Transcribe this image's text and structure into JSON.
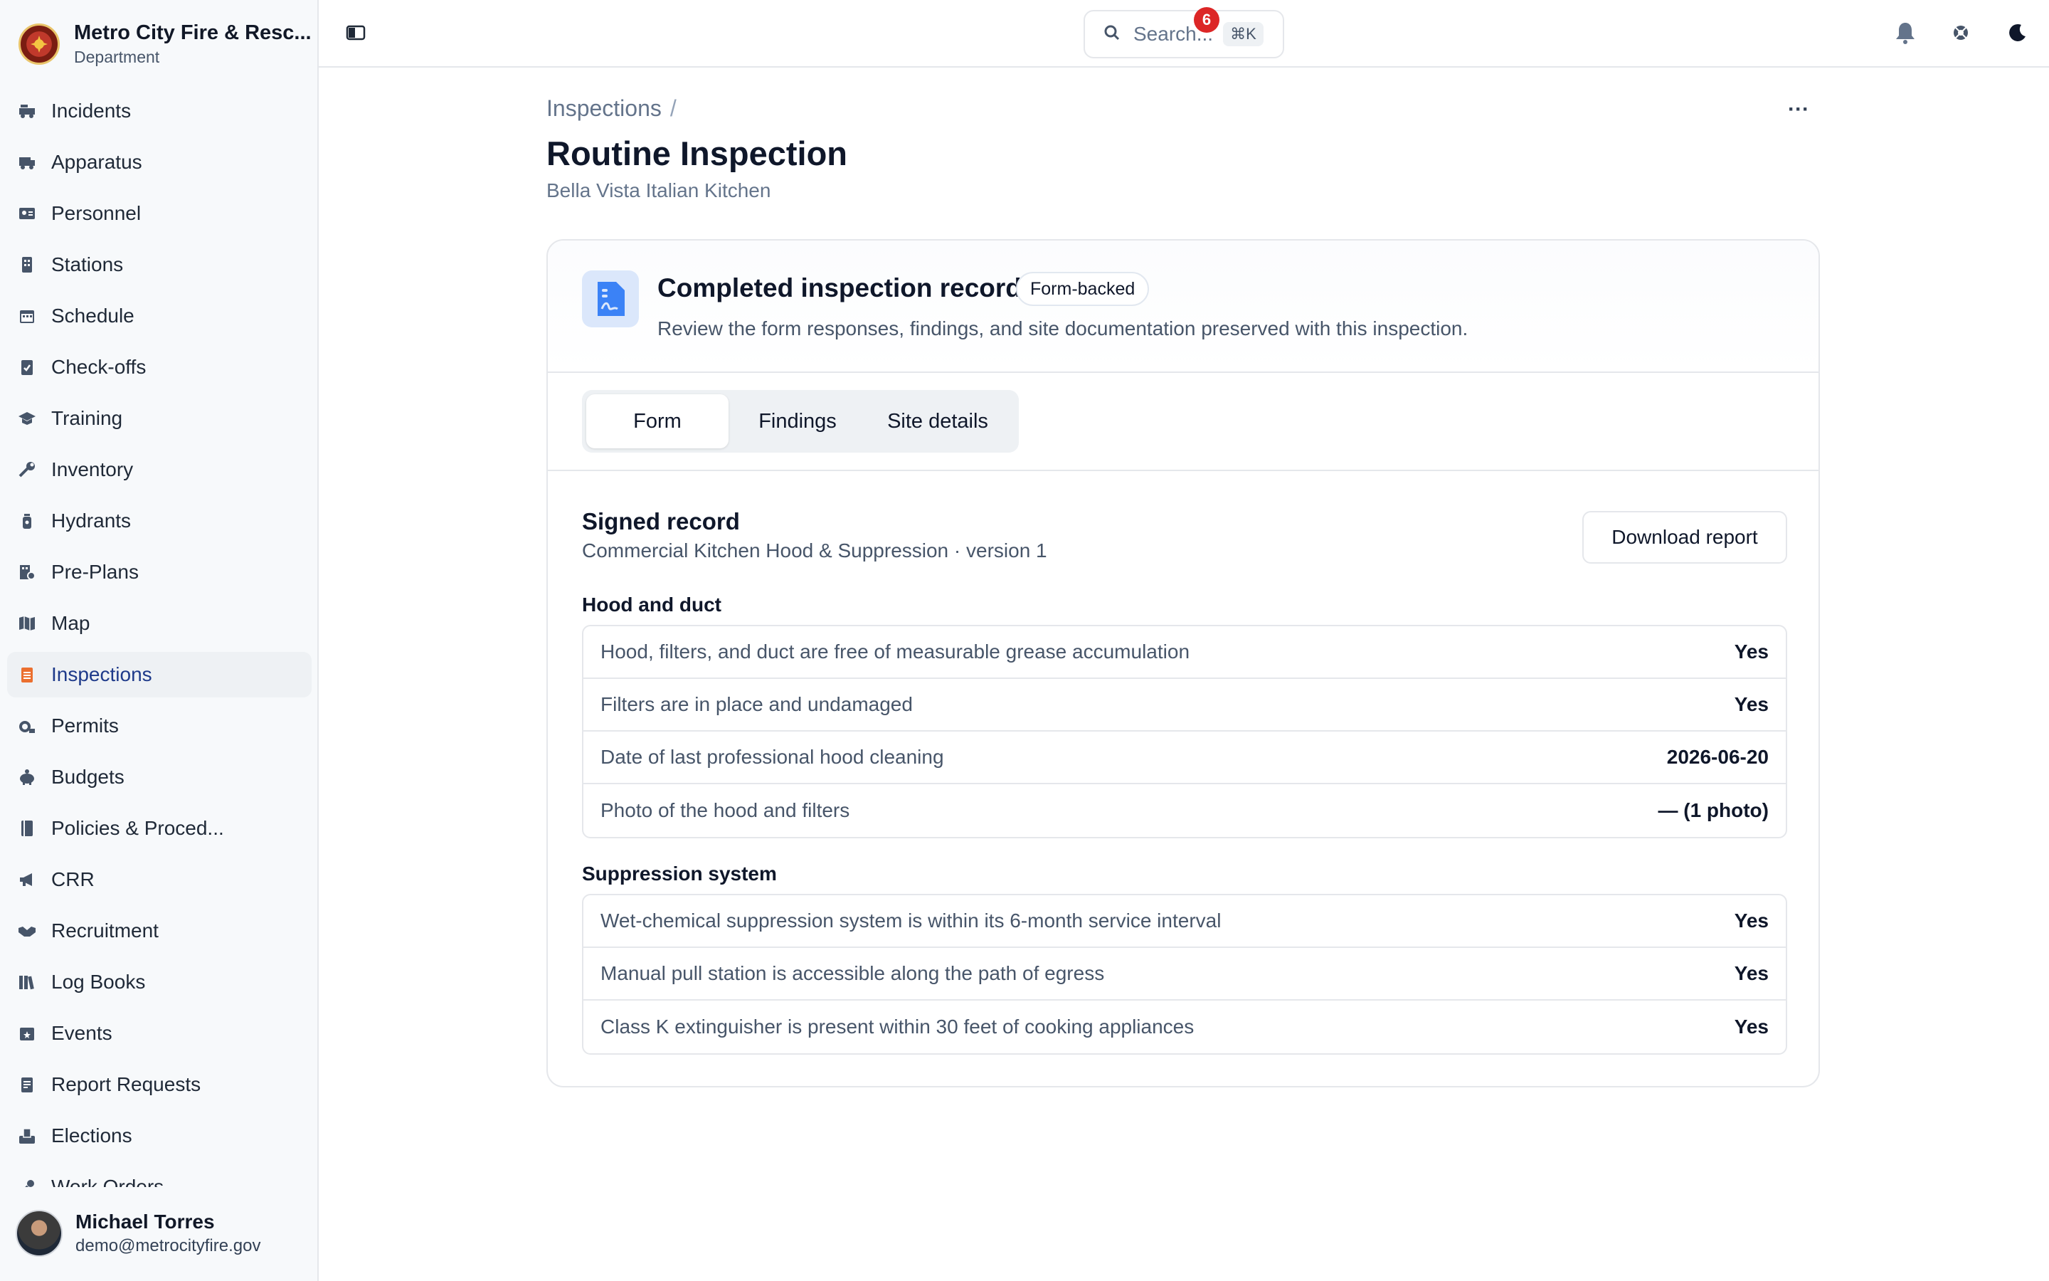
{
  "org": {
    "name": "Metro City Fire & Resc...",
    "sub": "Department"
  },
  "nav": [
    {
      "label": "Incidents",
      "icon": "fire-truck-icon"
    },
    {
      "label": "Apparatus",
      "icon": "truck-icon"
    },
    {
      "label": "Personnel",
      "icon": "id-card-icon"
    },
    {
      "label": "Stations",
      "icon": "building-icon"
    },
    {
      "label": "Schedule",
      "icon": "calendar-icon"
    },
    {
      "label": "Check-offs",
      "icon": "clipboard-check-icon"
    },
    {
      "label": "Training",
      "icon": "graduation-cap-icon"
    },
    {
      "label": "Inventory",
      "icon": "wrench-icon"
    },
    {
      "label": "Hydrants",
      "icon": "hydrant-icon"
    },
    {
      "label": "Pre-Plans",
      "icon": "building-plan-icon"
    },
    {
      "label": "Map",
      "icon": "map-icon"
    },
    {
      "label": "Inspections",
      "icon": "clipboard-list-icon"
    },
    {
      "label": "Permits",
      "icon": "stamp-icon"
    },
    {
      "label": "Budgets",
      "icon": "piggy-bank-icon"
    },
    {
      "label": "Policies & Proced...",
      "icon": "book-icon"
    },
    {
      "label": "CRR",
      "icon": "megaphone-icon"
    },
    {
      "label": "Recruitment",
      "icon": "handshake-icon"
    },
    {
      "label": "Log Books",
      "icon": "books-icon"
    },
    {
      "label": "Events",
      "icon": "calendar-star-icon"
    },
    {
      "label": "Report Requests",
      "icon": "file-icon"
    },
    {
      "label": "Elections",
      "icon": "ballot-box-icon"
    },
    {
      "label": "Work Orders",
      "icon": "tools-icon"
    }
  ],
  "active_nav": "Inspections",
  "user": {
    "name": "Michael Torres",
    "email": "demo@metrocityfire.gov"
  },
  "topbar": {
    "search_placeholder": "Search...",
    "search_shortcut": "⌘K",
    "notification_count": "6"
  },
  "breadcrumb": {
    "parent": "Inspections",
    "separator": "/"
  },
  "page": {
    "title": "Routine Inspection",
    "subtitle": "Bella Vista Italian Kitchen",
    "more": "···"
  },
  "card": {
    "title": "Completed inspection record",
    "tag": "Form-backed",
    "description": "Review the form responses, findings, and site documentation preserved with this inspection."
  },
  "tabs": [
    {
      "label": "Form",
      "active": true
    },
    {
      "label": "Findings",
      "active": false
    },
    {
      "label": "Site details",
      "active": false
    }
  ],
  "record": {
    "title": "Signed record",
    "subtitle": "Commercial Kitchen Hood & Suppression · version 1",
    "download_label": "Download report"
  },
  "sections": [
    {
      "title": "Hood and duct",
      "rows": [
        {
          "q": "Hood, filters, and duct are free of measurable grease accumulation",
          "a": "Yes"
        },
        {
          "q": "Filters are in place and undamaged",
          "a": "Yes"
        },
        {
          "q": "Date of last professional hood cleaning",
          "a": "2026-06-20"
        },
        {
          "q": "Photo of the hood and filters",
          "a": "— (1 photo)"
        }
      ]
    },
    {
      "title": "Suppression system",
      "rows": [
        {
          "q": "Wet-chemical suppression system is within its 6-month service interval",
          "a": "Yes"
        },
        {
          "q": "Manual pull station is accessible along the path of egress",
          "a": "Yes"
        },
        {
          "q": "Class K extinguisher is present within 30 feet of cooking appliances",
          "a": "Yes"
        }
      ]
    }
  ],
  "colors": {
    "accent": "#1e3a8a",
    "active_nav_icon": "#ea580c",
    "badge": "#dc2626",
    "doc_icon": "#2563eb"
  }
}
